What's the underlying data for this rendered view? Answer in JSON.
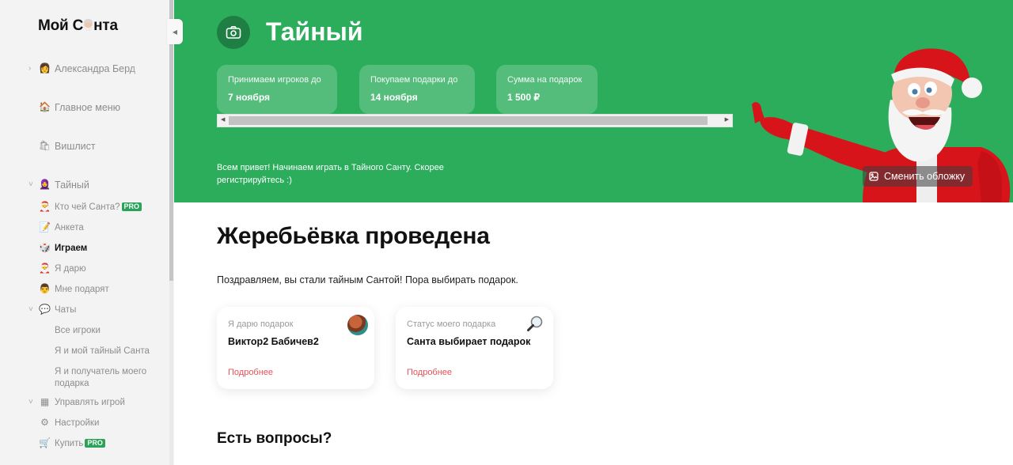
{
  "sidebar": {
    "logo": {
      "before": "Мой С",
      "after": "нта"
    },
    "collapse_icon": "triangle-left",
    "items": [
      {
        "label": "Александра Берд",
        "icon": "user-avatar",
        "emoji": "👩",
        "chevron": "›"
      },
      {
        "label": "Главное меню",
        "icon": "home",
        "emoji": "🏠"
      },
      {
        "label": "Вишлист",
        "icon": "gift-bag",
        "emoji": "🛍"
      },
      {
        "label": "Тайный",
        "icon": "game-avatar",
        "emoji": "🧕",
        "chevron": "˅"
      },
      {
        "label": "Кто чей Санта?",
        "icon": "santa-face",
        "emoji": "🎅",
        "badge": "PRO"
      },
      {
        "label": "Анкета",
        "icon": "pencil",
        "emoji": "📝"
      },
      {
        "label": "Играем",
        "icon": "dice",
        "emoji": "🎲",
        "active": true
      },
      {
        "label": "Я дарю",
        "icon": "santa-face",
        "emoji": "🎅"
      },
      {
        "label": "Мне подарят",
        "icon": "man-face",
        "emoji": "👨"
      },
      {
        "label": "Чаты",
        "icon": "chat-bubble",
        "emoji": "💬",
        "chevron": "˅"
      },
      {
        "label": "Все игроки"
      },
      {
        "label": "Я и мой тайный Санта"
      },
      {
        "label": "Я и получатель моего подарка"
      },
      {
        "label": "Управлять игрой",
        "icon": "grid",
        "emoji": "▦",
        "chevron": "˅"
      },
      {
        "label": "Настройки",
        "icon": "gear",
        "emoji": "⚙"
      },
      {
        "label": "Купить",
        "icon": "cart",
        "emoji": "🛒",
        "badge": "PRO"
      }
    ]
  },
  "cover": {
    "title": "Тайный",
    "camera_icon": "camera",
    "info_cards": [
      {
        "label": "Принимаем игроков до",
        "value": "7 ноября"
      },
      {
        "label": "Покупаем подарки до",
        "value": "14 ноября"
      },
      {
        "label": "Сумма на подарок",
        "value": "1 500 ₽"
      }
    ],
    "welcome_text": "Всем привет! Начинаем играть в Тайного Санту. Скорее регистрируйтесь :)",
    "change_cover_label": "Сменить обложку",
    "bg_color": "#2bad5c"
  },
  "content": {
    "heading": "Жеребьёвка проведена",
    "congrats": "Поздравляем, вы стали тайным Сантой! Пора выбирать подарок.",
    "cards": [
      {
        "label": "Я дарю подарок",
        "value": "Виктор2 Бабичев2",
        "link": "Подробнее",
        "icon": "recipient-avatar"
      },
      {
        "label": "Статус моего подарка",
        "value": "Санта выбирает подарок",
        "link": "Подробнее",
        "icon": "magnifier"
      }
    ],
    "questions_heading": "Есть вопросы?",
    "link_color": "#e9505a"
  }
}
